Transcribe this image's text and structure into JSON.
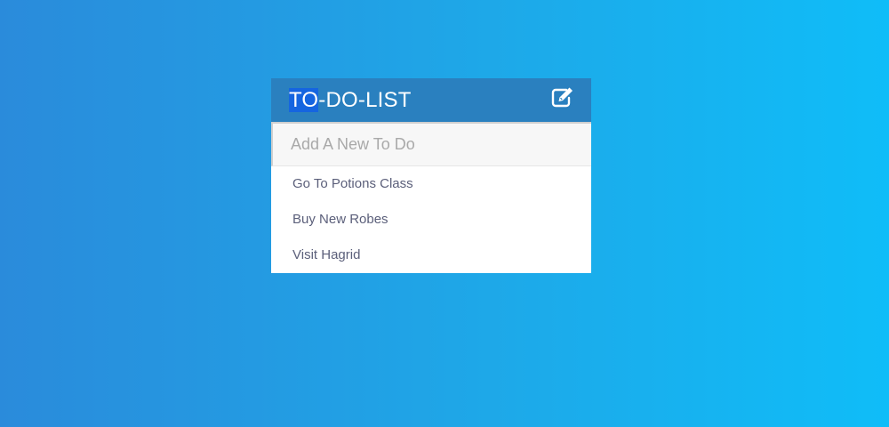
{
  "header": {
    "title_selected": "TO",
    "title_rest": "-DO-LIST",
    "edit_icon": "pencil-square-icon"
  },
  "new_todo": {
    "placeholder": "Add A New To Do",
    "value": ""
  },
  "todos": [
    {
      "label": "Go To Potions Class"
    },
    {
      "label": "Buy New Robes"
    },
    {
      "label": "Visit Hagrid"
    }
  ],
  "colors": {
    "background_start": "#2a8bdb",
    "background_end": "#0fbdf8",
    "header": "#2a80bf",
    "item_text": "#5b5f7a"
  }
}
